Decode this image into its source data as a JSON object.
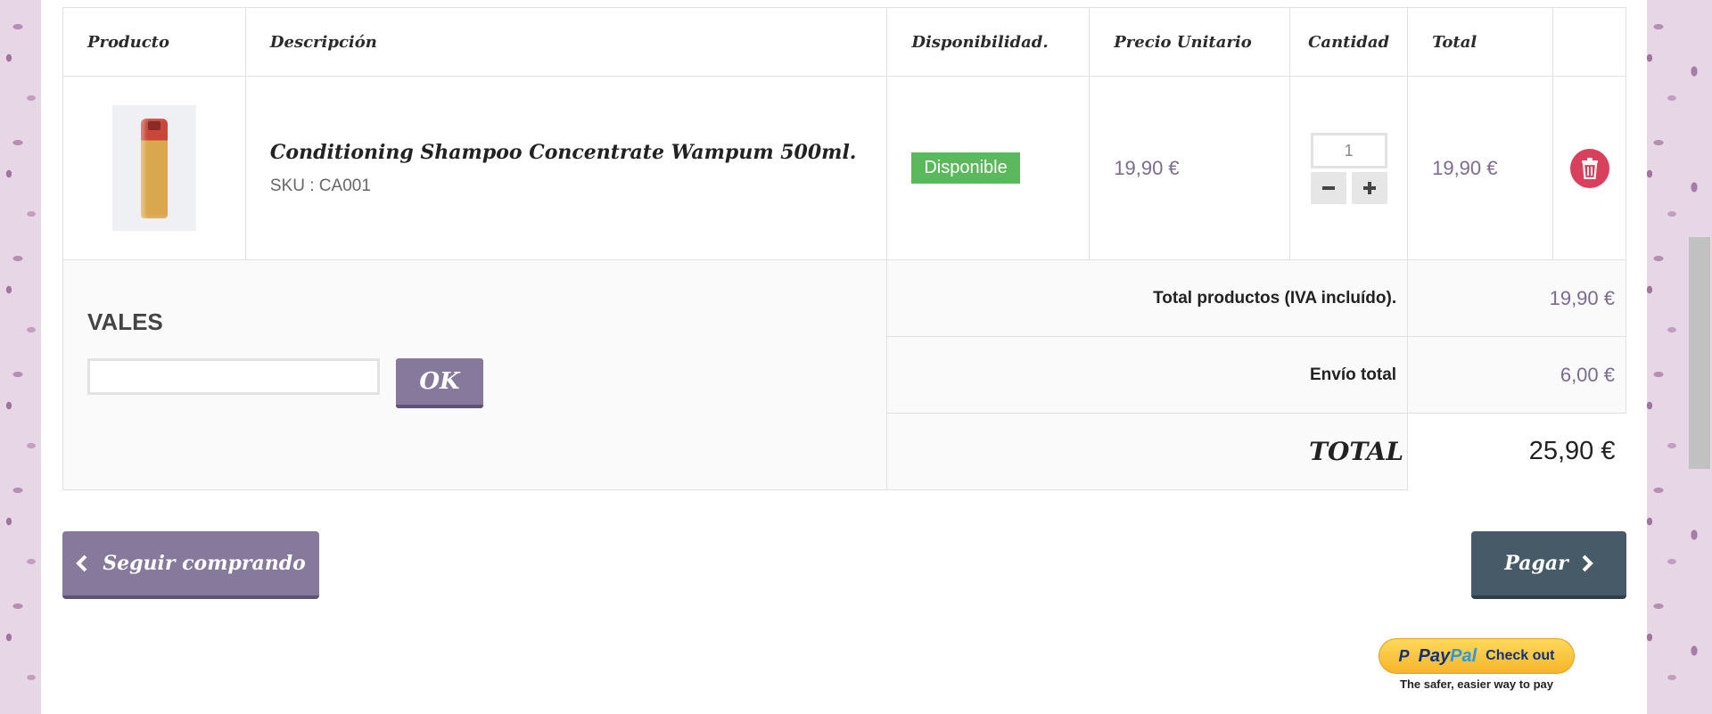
{
  "table": {
    "headers": {
      "product": "Producto",
      "description": "Descripción",
      "availability": "Disponibilidad.",
      "unit_price": "Precio Unitario",
      "quantity": "Cantidad",
      "total": "Total"
    },
    "item": {
      "name": "Conditioning Shampoo Concentrate Wampum 500ml.",
      "sku": "SKU : CA001",
      "availability": "Disponible",
      "unit_price": "19,90 €",
      "quantity": "1",
      "total": "19,90 €"
    }
  },
  "vales": {
    "title": "VALES",
    "input_value": "",
    "ok_label": "OK"
  },
  "totals": {
    "products_label": "Total productos (IVA incluído).",
    "products_value": "19,90 €",
    "shipping_label": "Envío total",
    "shipping_value": "6,00 €",
    "grand_label": "TOTAL",
    "grand_value": "25,90 €"
  },
  "actions": {
    "continue_label": "Seguir comprando",
    "pay_label": "Pagar"
  },
  "paypal": {
    "brand_pay": "Pay",
    "brand_pal": "Pal",
    "checkout": "Check out",
    "tagline": "The safer, easier way to pay"
  },
  "colors": {
    "accent": "#87799c",
    "pay": "#475a67",
    "available": "#5cb85c",
    "delete": "#d9405b"
  }
}
